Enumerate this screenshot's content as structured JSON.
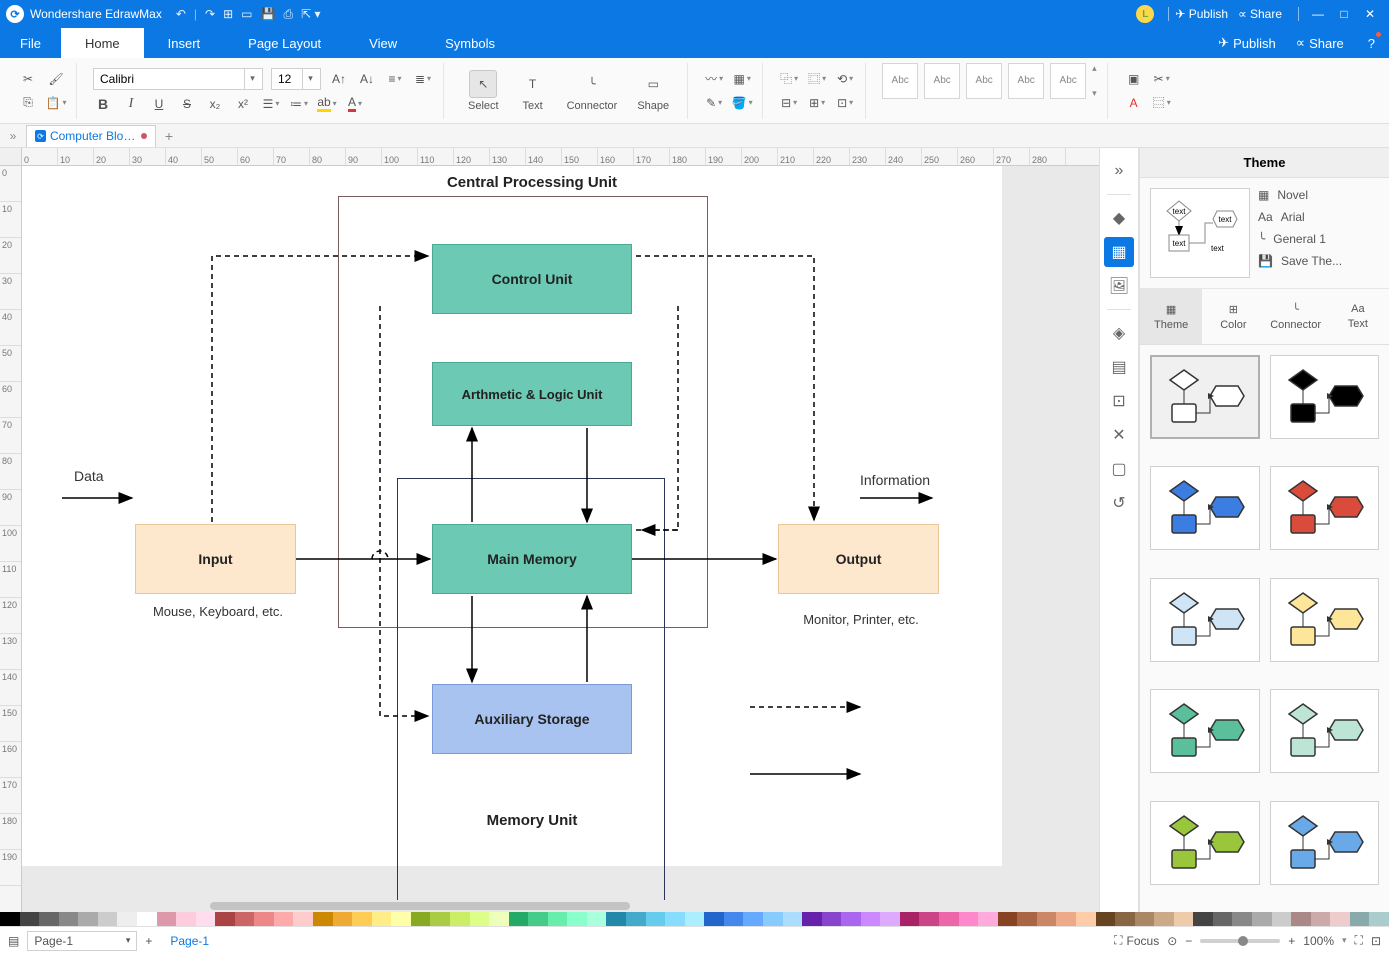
{
  "app": {
    "title": "Wondershare EdrawMax"
  },
  "titlebar_actions": {
    "publish": "Publish",
    "share": "Share"
  },
  "menu": {
    "file": "File",
    "home": "Home",
    "insert": "Insert",
    "page_layout": "Page Layout",
    "view": "View",
    "symbols": "Symbols"
  },
  "ribbon": {
    "font": "Calibri",
    "size": "12",
    "select": "Select",
    "text": "Text",
    "connector": "Connector",
    "shape": "Shape",
    "stylebox_label": "Abc"
  },
  "doc": {
    "tab_name": "Computer Block..."
  },
  "ruler_h": [
    "0",
    "10",
    "20",
    "30",
    "40",
    "50",
    "60",
    "70",
    "80",
    "90",
    "100",
    "110",
    "120",
    "130",
    "140",
    "150",
    "160",
    "170",
    "180",
    "190",
    "200",
    "210",
    "220",
    "230",
    "240",
    "250",
    "260",
    "270",
    "280"
  ],
  "ruler_v": [
    "0",
    "10",
    "20",
    "30",
    "40",
    "50",
    "60",
    "70",
    "80",
    "90",
    "100",
    "110",
    "120",
    "130",
    "140",
    "150",
    "160",
    "170",
    "180",
    "190"
  ],
  "diagram": {
    "cpu_title": "Central Processing Unit",
    "mem_title": "Memory Unit",
    "control": "Control Unit",
    "alu": "Arthmetic & Logic Unit",
    "main_mem": "Main Memory",
    "aux": "Auxiliary Storage",
    "input": "Input",
    "output": "Output",
    "input_sub": "Mouse, Keyboard, etc.",
    "output_sub": "Monitor, Printer, etc.",
    "data": "Data",
    "info": "Information"
  },
  "theme": {
    "title": "Theme",
    "novel": "Novel",
    "arial": "Arial",
    "general1": "General 1",
    "save": "Save The...",
    "tab_theme": "Theme",
    "tab_color": "Color",
    "tab_connector": "Connector",
    "tab_text": "Text",
    "preview_text": "text"
  },
  "status": {
    "page_sel": "Page-1",
    "page_tab": "Page-1",
    "focus": "Focus",
    "zoom": "100%"
  },
  "colors": [
    "#000",
    "#444",
    "#666",
    "#888",
    "#aaa",
    "#ccc",
    "#eee",
    "#fff",
    "#d9a",
    "#fcd",
    "#fde",
    "#a44",
    "#c66",
    "#e88",
    "#faa",
    "#fcc",
    "#c80",
    "#ea3",
    "#fc5",
    "#fe8",
    "#ffa",
    "#8a2",
    "#ac4",
    "#ce6",
    "#df8",
    "#efb",
    "#2a6",
    "#4c8",
    "#6ea",
    "#8fc",
    "#afd",
    "#28a",
    "#4ac",
    "#6ce",
    "#8df",
    "#aef",
    "#26c",
    "#48e",
    "#6af",
    "#8cf",
    "#adf",
    "#62a",
    "#84c",
    "#a6e",
    "#c8f",
    "#daf",
    "#a26",
    "#c48",
    "#e6a",
    "#f8c",
    "#fad",
    "#842",
    "#a64",
    "#c86",
    "#ea8",
    "#fca",
    "#642",
    "#864",
    "#a86",
    "#ca8",
    "#eca",
    "#444",
    "#666",
    "#888",
    "#aaa",
    "#ccc",
    "#a88",
    "#caa",
    "#ecc",
    "#8aa",
    "#acc"
  ]
}
